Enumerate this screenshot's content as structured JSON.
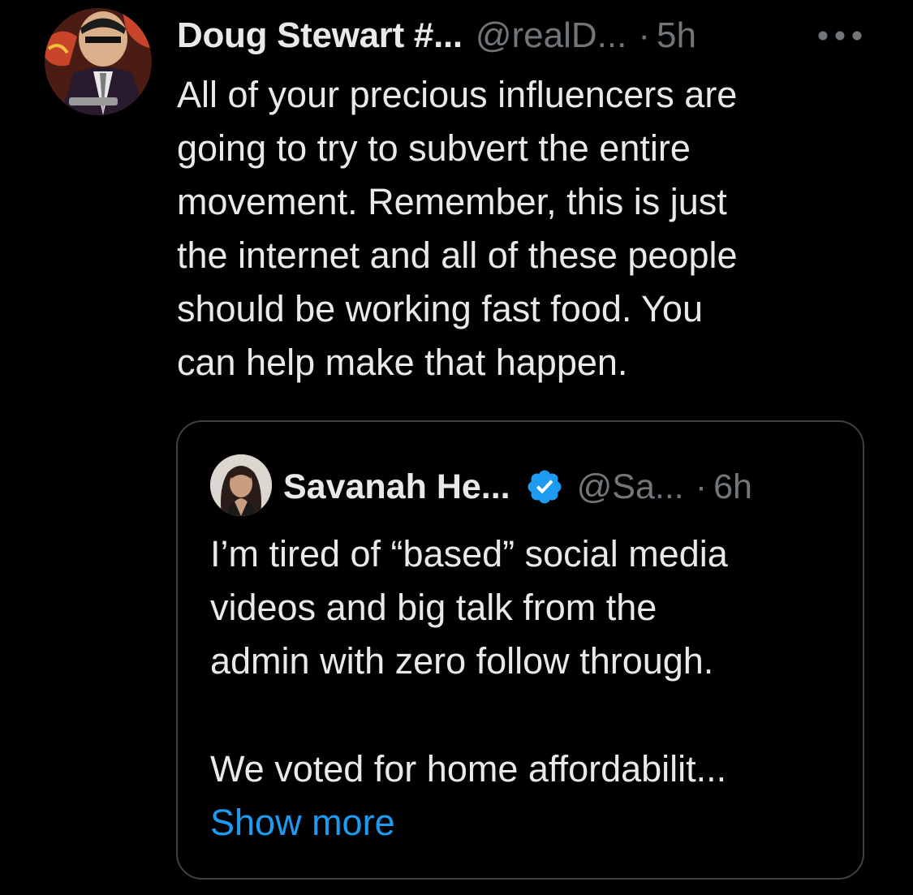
{
  "tweet": {
    "author_name": "Doug Stewart #...",
    "author_handle": "@realD...",
    "dot": "·",
    "time": "5h",
    "more_icon": "more-horizontal-icon",
    "text": "All of your precious influencers are\ngoing to try to subvert the entire\nmovement. Remember, this is just\nthe internet and all of these people\nshould be working fast food. You\ncan help make that happen."
  },
  "quoted": {
    "author_name": "Savanah He...",
    "verified_icon": "verified-badge-icon",
    "author_handle": "@Sa...",
    "dot": "·",
    "time": "6h",
    "text": "I’m tired of “based” social media\nvideos and big talk from the\nadmin with zero follow through.",
    "text_continued": "We voted for home affordabilit...",
    "show_more": "Show more"
  },
  "colors": {
    "background": "#000000",
    "text_primary": "#e7e9ea",
    "text_secondary": "#71767b",
    "link": "#1d9bf0",
    "verified": "#1d9bf0",
    "border": "#3e4144"
  }
}
